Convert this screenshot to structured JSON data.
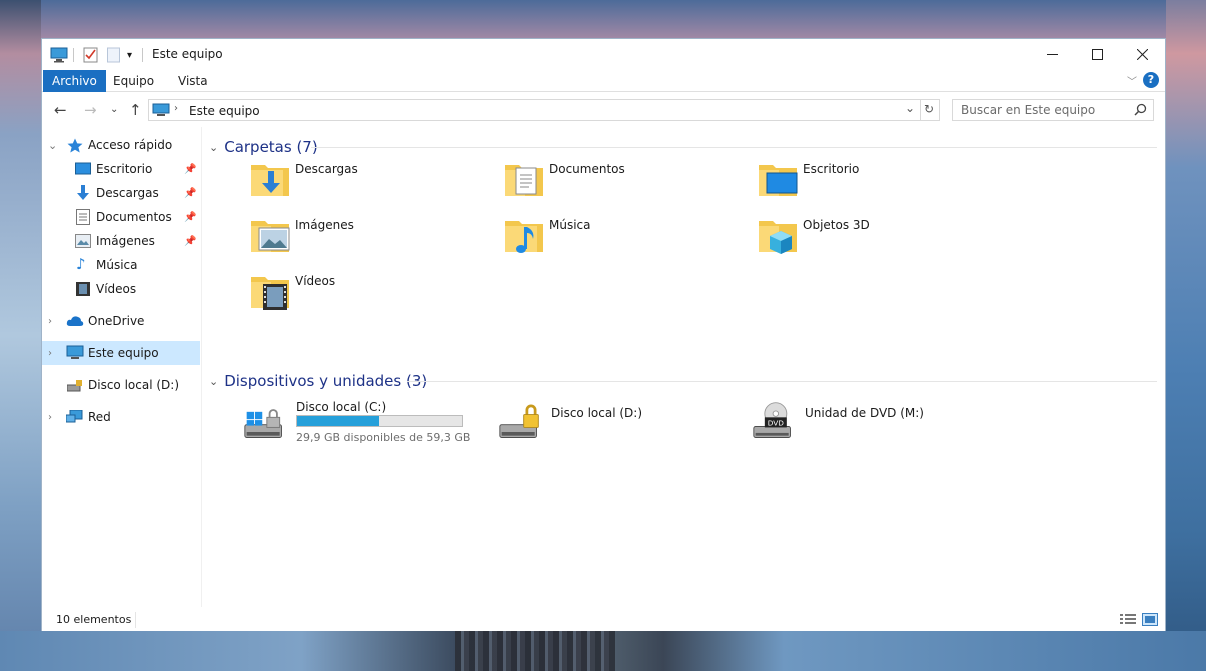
{
  "window": {
    "title": "Este equipo"
  },
  "controls": {
    "minimize": "—",
    "maximize": "☐",
    "close": "✕"
  },
  "ribbon": {
    "tabs": [
      "Archivo",
      "Equipo",
      "Vista"
    ],
    "help": "?"
  },
  "address": {
    "path": "Este equipo"
  },
  "search": {
    "placeholder": "Buscar en Este equipo"
  },
  "nav": {
    "quick_access": "Acceso rápido",
    "pinned": [
      "Escritorio",
      "Descargas",
      "Documentos",
      "Imágenes"
    ],
    "others": [
      "Música",
      "Vídeos"
    ],
    "onedrive": "OneDrive",
    "this_pc": "Este equipo",
    "drive_d": "Disco local (D:)",
    "network": "Red"
  },
  "folders_group": "Carpetas (7)",
  "folders": [
    "Descargas",
    "Documentos",
    "Escritorio",
    "Imágenes",
    "Música",
    "Objetos 3D",
    "Vídeos"
  ],
  "devices_group": "Dispositivos y unidades (3)",
  "devices": [
    {
      "name": "Disco local (C:)",
      "space": "29,9 GB disponibles de 59,3 GB",
      "used_fraction": 0.496
    },
    {
      "name": "Disco local (D:)"
    },
    {
      "name": "Unidad de DVD (M:)",
      "badge": "DVD"
    }
  ],
  "status": {
    "count": "10 elementos"
  },
  "colors": {
    "accent": "#1a6fc2",
    "selection": "#cce8ff",
    "group_header": "#1e3287",
    "progress": "#26a0da"
  }
}
